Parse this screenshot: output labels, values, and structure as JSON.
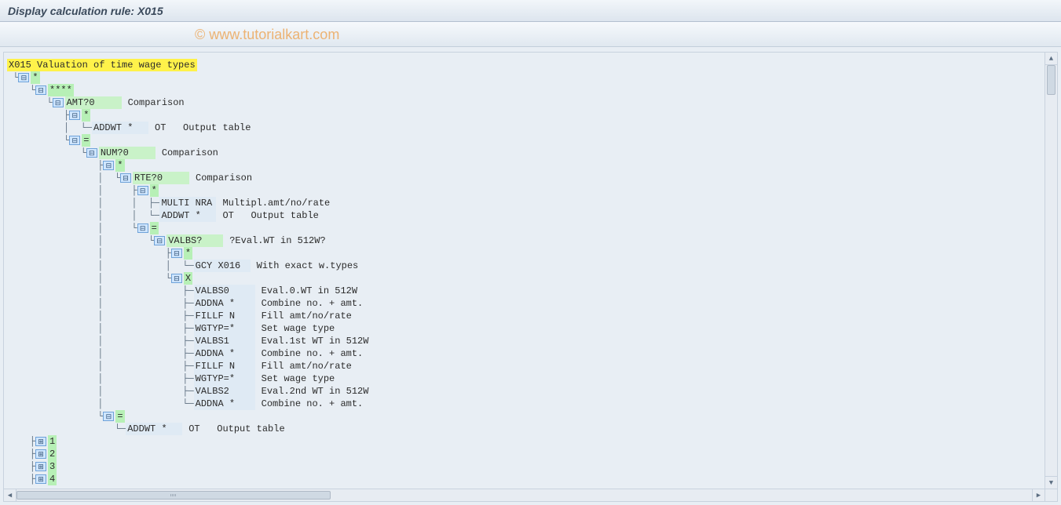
{
  "header": {
    "title": "Display calculation rule: X015"
  },
  "watermark": "© www.tutorialkart.com",
  "root": {
    "code": "X015",
    "desc": "Valuation of time wage types"
  },
  "n": {
    "star": "*",
    "quad_star": "****",
    "amt": "AMT?0",
    "comparison": "Comparison",
    "addwt": "ADDWT *",
    "ot": "OT",
    "output_table": "Output table",
    "eq": "=",
    "num": "NUM?0",
    "rte": "RTE?0",
    "multi": "MULTI NRA",
    "multi_desc": "Multipl.amt/no/rate",
    "valbsq": "VALBS?",
    "valbsq_desc": "?Eval.WT in 512W?",
    "gcy": "GCY X016",
    "gcy_desc": "With exact w.types",
    "x": "X",
    "valbs0": "VALBS0",
    "valbs0_desc": "Eval.0.WT in 512W",
    "addna": "ADDNA *",
    "addna_desc": "Combine no. + amt.",
    "fillf": "FILLF N",
    "fillf_desc": "Fill amt/no/rate",
    "wgtyp": "WGTYP=*",
    "wgtyp_desc": "Set wage type",
    "valbs1": "VALBS1",
    "valbs1_desc": "Eval.1st WT in 512W",
    "valbs2": "VALBS2",
    "valbs2_desc": "Eval.2nd WT in 512W",
    "one": "1",
    "two": "2",
    "three": "3",
    "four": "4"
  }
}
